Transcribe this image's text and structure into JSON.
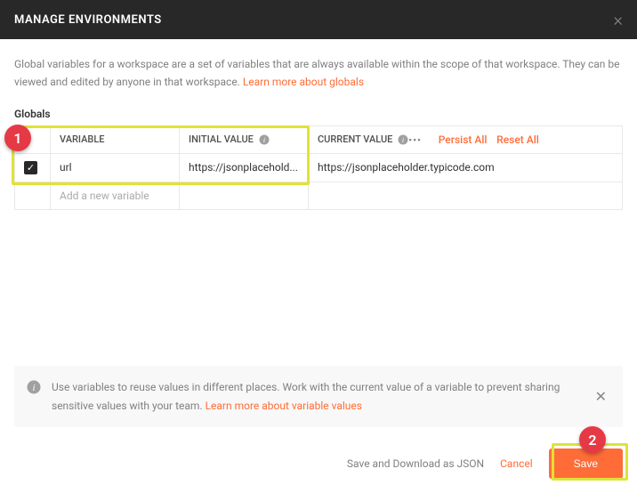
{
  "header": {
    "title": "MANAGE ENVIRONMENTS"
  },
  "description": {
    "text1": "Global variables for a workspace are a set of variables that are always available within the scope of that workspace. They can be viewed and edited by anyone in that workspace. ",
    "link": "Learn more about globals"
  },
  "section": {
    "title": "Globals"
  },
  "table": {
    "headers": {
      "variable": "VARIABLE",
      "initial_value": "INITIAL VALUE",
      "current_value": "CURRENT VALUE",
      "persist_all": "Persist All",
      "reset_all": "Reset All"
    },
    "rows": [
      {
        "checked": true,
        "variable": "url",
        "initial_value": "https://jsonplacehold...",
        "current_value": "https://jsonplaceholder.typicode.com"
      }
    ],
    "placeholder": "Add a new variable"
  },
  "hint": {
    "text1": "Use variables to reuse values in different places. Work with the current value of a variable to prevent sharing sensitive values with your team. ",
    "link": "Learn more about variable values"
  },
  "footer": {
    "save_download": "Save and Download as JSON",
    "cancel": "Cancel",
    "save": "Save"
  },
  "badges": {
    "one": "1",
    "two": "2"
  },
  "watermark": ""
}
